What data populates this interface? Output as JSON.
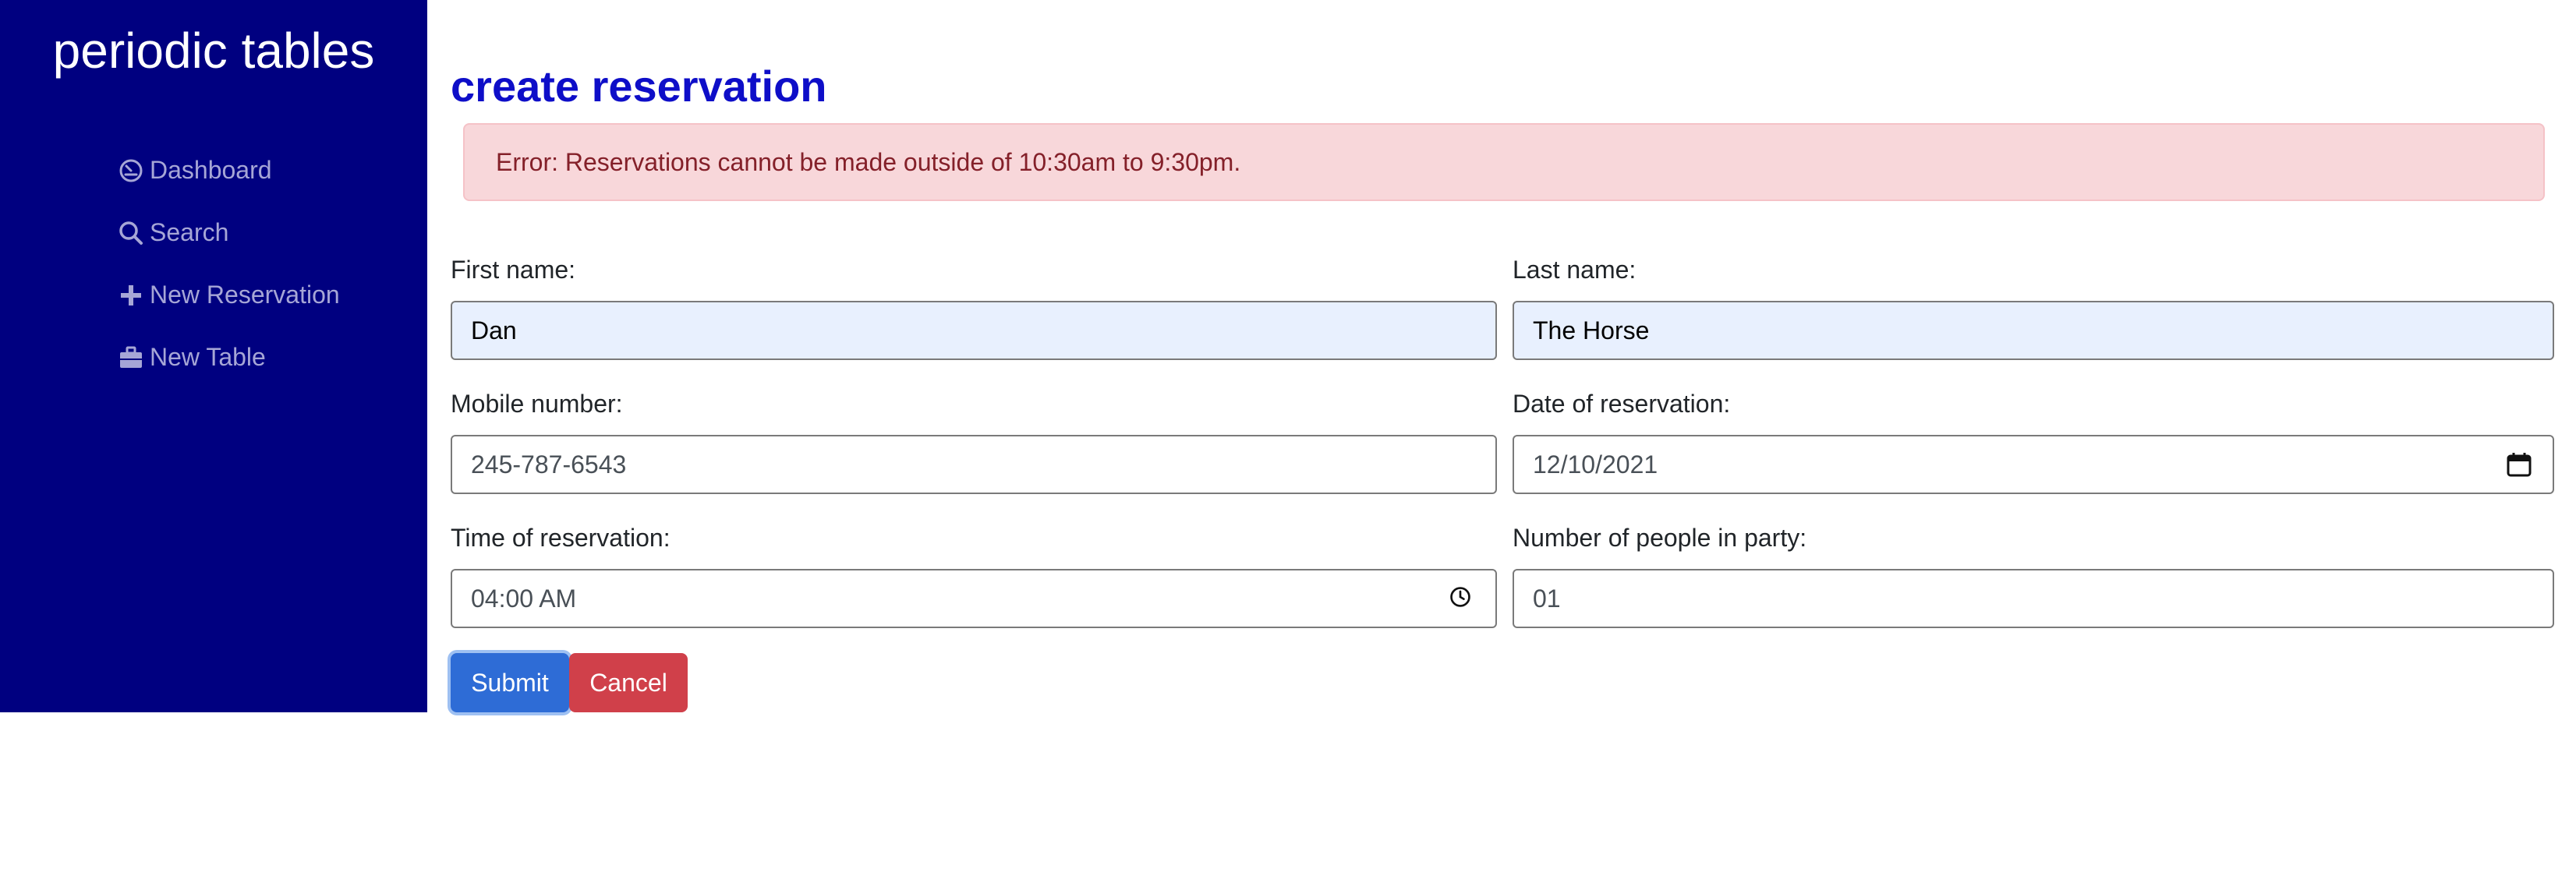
{
  "sidebar": {
    "brand": "periodic tables",
    "items": [
      {
        "label": "Dashboard",
        "icon": "dashboard-icon"
      },
      {
        "label": "Search",
        "icon": "search-icon"
      },
      {
        "label": "New Reservation",
        "icon": "plus-icon"
      },
      {
        "label": "New Table",
        "icon": "briefcase-icon"
      }
    ],
    "background": "#000080",
    "item_color": "#a6a6d6"
  },
  "main": {
    "title": "create reservation",
    "title_color": "#0e0ec8",
    "error": "Error: Reservations cannot be made outside of 10:30am to 9:30pm.",
    "form": {
      "first_name": {
        "label": "First name:",
        "value": "Dan"
      },
      "last_name": {
        "label": "Last name:",
        "value": "The Horse"
      },
      "mobile_number": {
        "label": "Mobile number:",
        "value": "245-787-6543"
      },
      "date": {
        "label": "Date of reservation:",
        "value": "12/10/2021",
        "icon": "calendar-icon"
      },
      "time": {
        "label": "Time of reservation:",
        "value": "04:00 AM",
        "icon": "clock-icon"
      },
      "people": {
        "label": "Number of people in party:",
        "value": "01"
      }
    },
    "buttons": {
      "submit": "Submit",
      "cancel": "Cancel"
    }
  }
}
